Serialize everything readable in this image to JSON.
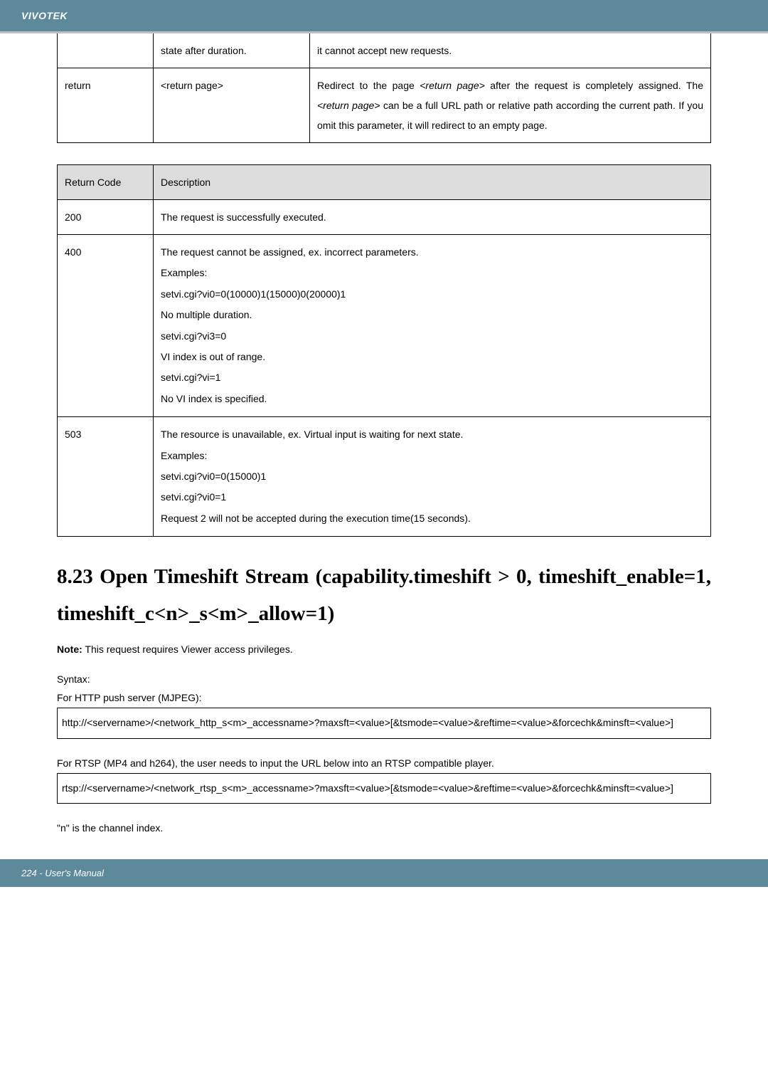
{
  "header": {
    "brand": "VIVOTEK"
  },
  "params_table": {
    "row_state": {
      "col2": "state after duration.",
      "col3": "it cannot accept new requests."
    },
    "row_return": {
      "col1": "return",
      "col2": "<return page>",
      "col3_part1": "Redirect to the page ",
      "col3_italic1": "<return page>",
      "col3_part2": " after the request is completely assigned. The ",
      "col3_italic2": "<return page>",
      "col3_part3": " can be a full URL path or relative path according the current path. If you omit this parameter, it will redirect to an empty page."
    }
  },
  "return_table": {
    "head": {
      "code": "Return Code",
      "desc": "Description"
    },
    "r200": {
      "code": "200",
      "desc": "The request is successfully executed."
    },
    "r400": {
      "code": "400",
      "lines": {
        "l0": "The request cannot be assigned, ex. incorrect parameters.",
        "l1": "Examples:",
        "l2": "setvi.cgi?vi0=0(10000)1(15000)0(20000)1",
        "l3": "No multiple duration.",
        "l4": "setvi.cgi?vi3=0",
        "l5": "VI index is out of range.",
        "l6": "setvi.cgi?vi=1",
        "l7": "No VI index is specified."
      }
    },
    "r503": {
      "code": "503",
      "lines": {
        "l0": "The resource is unavailable, ex. Virtual input is waiting for next state.",
        "l1": "Examples:",
        "l2": "setvi.cgi?vi0=0(15000)1",
        "l3": "setvi.cgi?vi0=1",
        "l4": "Request 2 will not be accepted during the execution time(15 seconds)."
      }
    }
  },
  "section": {
    "heading": "8.23 Open Timeshift Stream (capability.timeshift > 0, timeshift_enable=1, timeshift_c<n>_s<m>_allow=1)",
    "note_strong": "Note:",
    "note_rest": " This request requires Viewer access privileges.",
    "syntax_label": "Syntax:",
    "http_label": "For HTTP push server (MJPEG):",
    "http_box": "http://<servername>/<network_http_s<m>_accessname>?maxsft=<value>[&tsmode=<value>&reftime=<value>&forcechk&minsft=<value>]",
    "rtsp_label": "For RTSP (MP4 and h264), the user needs to input the URL below into an RTSP compatible player.",
    "rtsp_box": "rtsp://<servername>/<network_rtsp_s<m>_accessname>?maxsft=<value>[&tsmode=<value>&reftime=<value>&forcechk&minsft=<value>]",
    "n_note": "\"n\" is the channel index."
  },
  "footer": {
    "text": "224 - User's Manual"
  }
}
